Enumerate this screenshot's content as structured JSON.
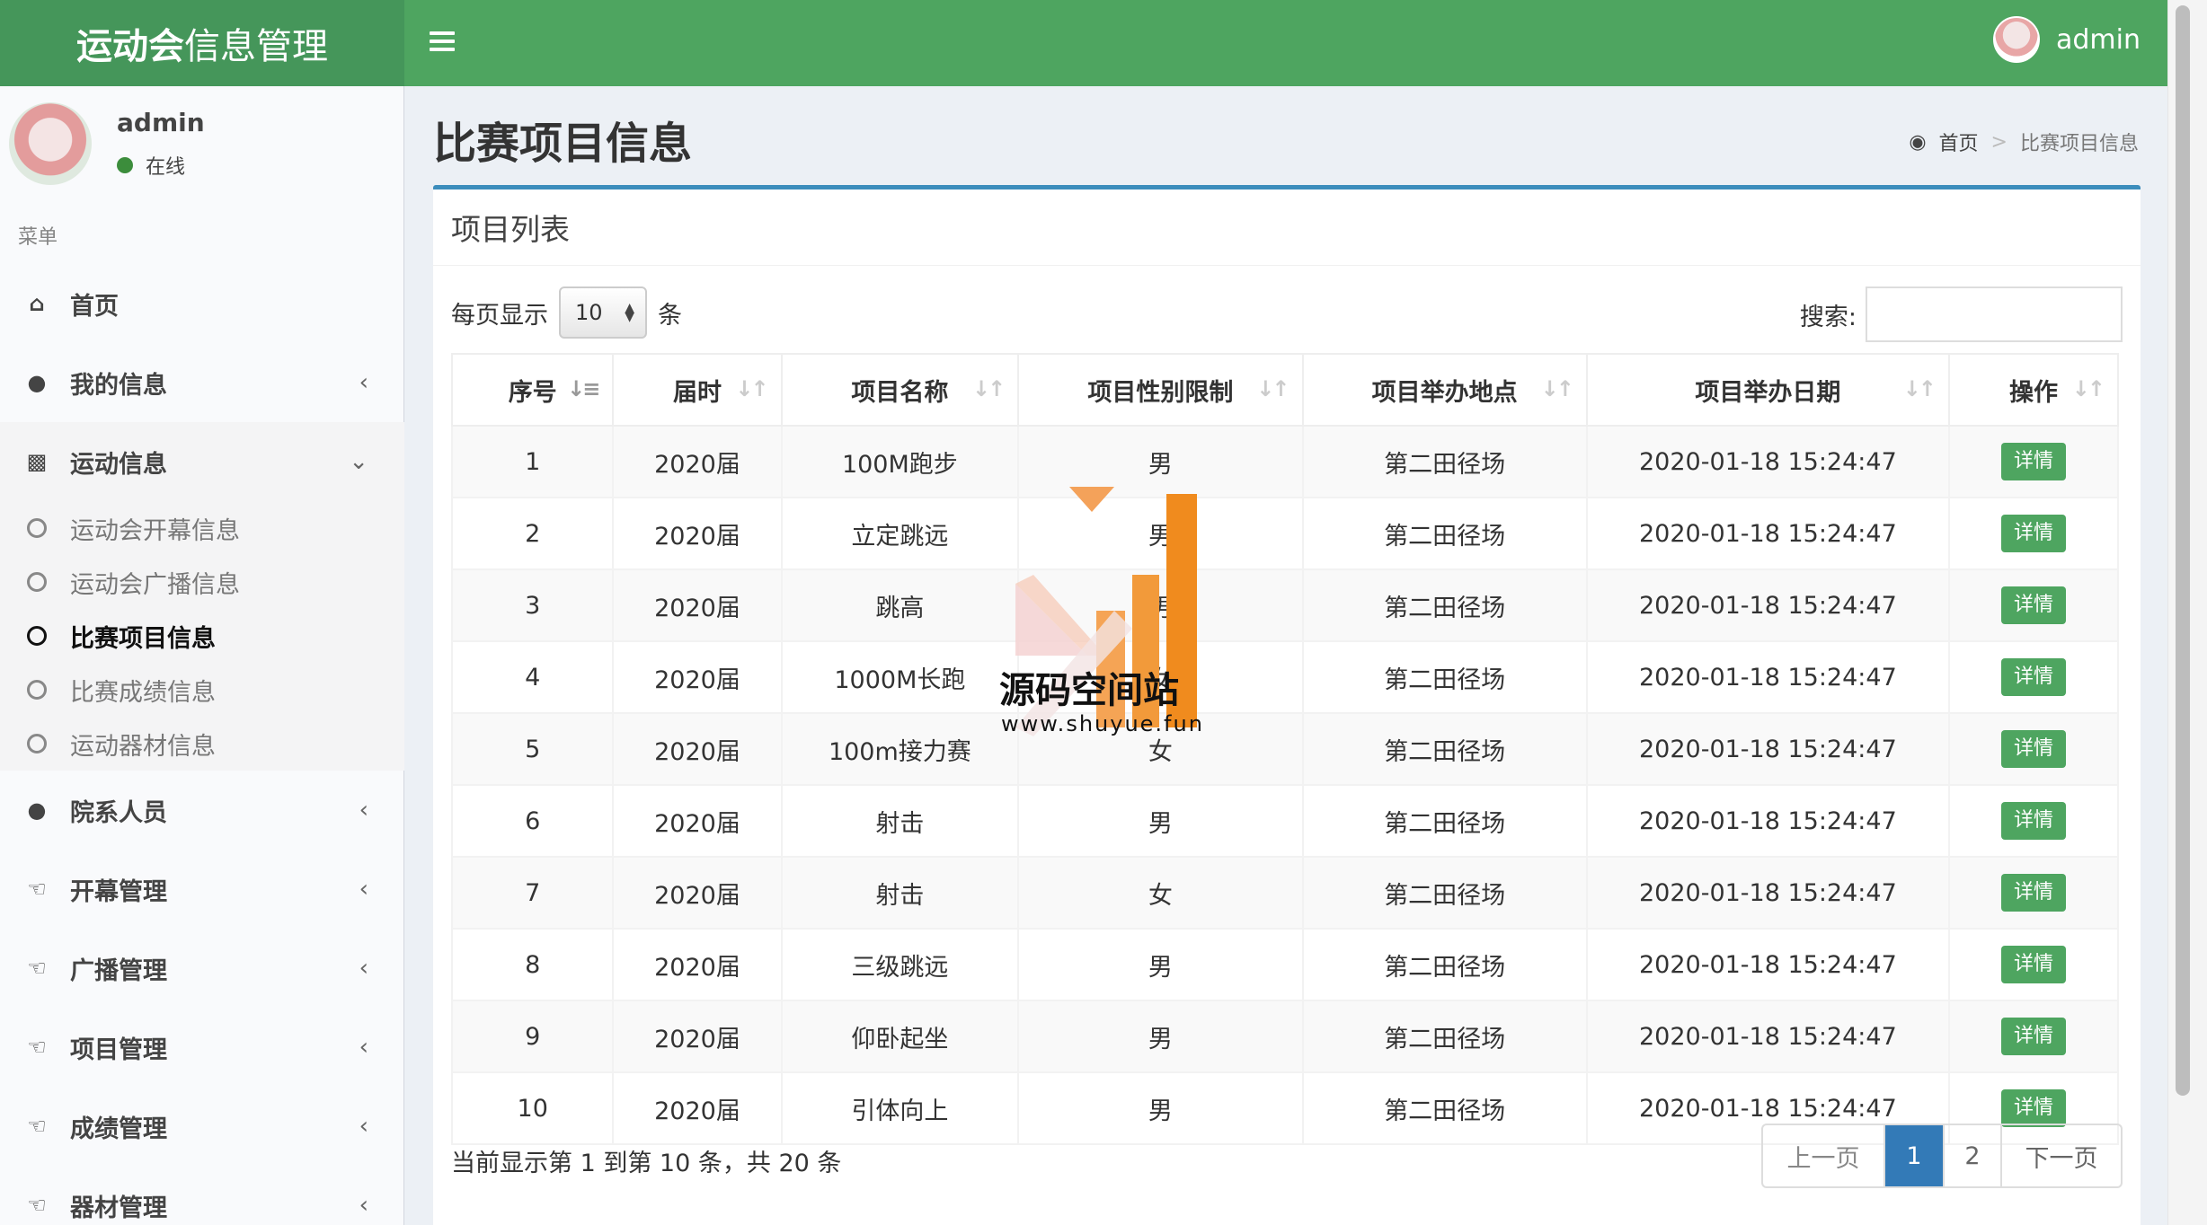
{
  "header": {
    "logo_bold": "运动会",
    "logo_light": "信息管理",
    "user": "admin"
  },
  "sidebar": {
    "user_name": "admin",
    "status": "在线",
    "menu_header": "菜单",
    "items": [
      {
        "label": "首页",
        "icon": "home-icon"
      },
      {
        "label": "我的信息",
        "icon": "user-icon"
      },
      {
        "label": "运动信息",
        "icon": "bar-chart-icon"
      },
      {
        "label": "院系人员",
        "icon": "users-icon"
      },
      {
        "label": "开幕管理",
        "icon": "thumbs-up-icon"
      },
      {
        "label": "广播管理",
        "icon": "thumbs-up-icon"
      },
      {
        "label": "项目管理",
        "icon": "thumbs-up-icon"
      },
      {
        "label": "成绩管理",
        "icon": "thumbs-up-icon"
      },
      {
        "label": "器材管理",
        "icon": "thumbs-up-icon"
      }
    ],
    "submenu": [
      "运动会开幕信息",
      "运动会广播信息",
      "比赛项目信息",
      "比赛成绩信息",
      "运动器材信息"
    ]
  },
  "page": {
    "title": "比赛项目信息",
    "breadcrumb_home": "首页",
    "breadcrumb_sep": ">",
    "breadcrumb_current": "比赛项目信息"
  },
  "box": {
    "title": "项目列表",
    "length_prefix": "每页显示",
    "length_value": "10",
    "length_suffix": "条",
    "search_label": "搜索:",
    "columns": [
      "序号",
      "届时",
      "项目名称",
      "项目性别限制",
      "项目举办地点",
      "项目举办日期",
      "操作"
    ],
    "rows": [
      [
        "1",
        "2020届",
        "100M跑步",
        "男",
        "第二田径场",
        "2020-01-18 15:24:47"
      ],
      [
        "2",
        "2020届",
        "立定跳远",
        "男",
        "第二田径场",
        "2020-01-18 15:24:47"
      ],
      [
        "3",
        "2020届",
        "跳高",
        "男",
        "第二田径场",
        "2020-01-18 15:24:47"
      ],
      [
        "4",
        "2020届",
        "1000M长跑",
        "女",
        "第二田径场",
        "2020-01-18 15:24:47"
      ],
      [
        "5",
        "2020届",
        "100m接力赛",
        "女",
        "第二田径场",
        "2020-01-18 15:24:47"
      ],
      [
        "6",
        "2020届",
        "射击",
        "男",
        "第二田径场",
        "2020-01-18 15:24:47"
      ],
      [
        "7",
        "2020届",
        "射击",
        "女",
        "第二田径场",
        "2020-01-18 15:24:47"
      ],
      [
        "8",
        "2020届",
        "三级跳远",
        "男",
        "第二田径场",
        "2020-01-18 15:24:47"
      ],
      [
        "9",
        "2020届",
        "仰卧起坐",
        "男",
        "第二田径场",
        "2020-01-18 15:24:47"
      ],
      [
        "10",
        "2020届",
        "引体向上",
        "男",
        "第二田径场",
        "2020-01-18 15:24:47"
      ]
    ],
    "detail_label": "详情",
    "info": "当前显示第 1 到第 10 条，共 20 条",
    "pager": {
      "prev": "上一页",
      "p1": "1",
      "p2": "2",
      "next": "下一页"
    }
  },
  "watermark": {
    "name": "源码空间站",
    "url": "www.shuyue.fun"
  },
  "colors": {
    "header": "#4ea560",
    "logo_bg": "#45965a",
    "accent": "#3c8dbc",
    "primary": "#337ab7"
  }
}
